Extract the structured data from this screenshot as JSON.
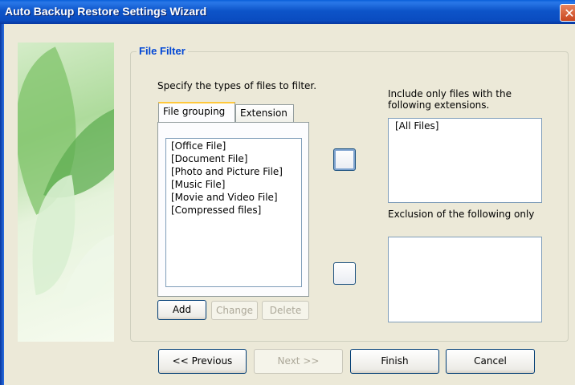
{
  "window": {
    "title": "Auto Backup Restore Settings Wizard",
    "close_glyph": "✕"
  },
  "file_filter": {
    "legend": "File Filter",
    "instruction": "Specify the types of files to filter.",
    "tabs": [
      {
        "label": "File grouping",
        "active": true
      },
      {
        "label": "Extension",
        "active": false
      }
    ],
    "groups": [
      "[Office File]",
      "[Document File]",
      "[Photo and Picture File]",
      "[Music File]",
      "[Movie and Video File]",
      "[Compressed files]"
    ],
    "buttons": {
      "add": "Add",
      "change": "Change",
      "delete": "Delete"
    },
    "include_label": "Include only files with the following extensions.",
    "include_items": [
      "[All Files]"
    ],
    "exclude_label": "Exclusion of the following only",
    "exclude_items": []
  },
  "footer": {
    "previous": "<< Previous",
    "next": "Next >>",
    "finish": "Finish",
    "cancel": "Cancel"
  },
  "colors": {
    "titlebar": "#0a4cc0",
    "dialog_bg": "#ece9d8",
    "legend": "#0046d5",
    "tab_highlight": "#ffc83c"
  }
}
